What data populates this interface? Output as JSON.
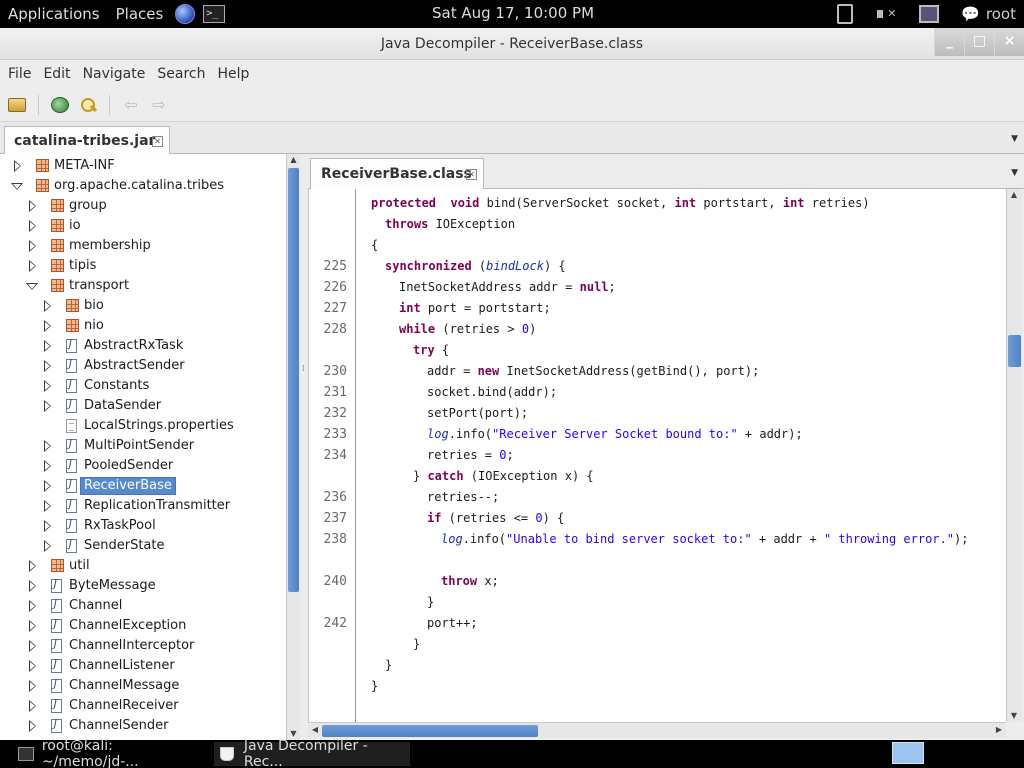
{
  "top_panel": {
    "applications": "Applications",
    "places": "Places",
    "clock": "Sat Aug 17, 10:00 PM",
    "user": "root"
  },
  "window": {
    "title": "Java Decompiler - ReceiverBase.class",
    "minimize": "_",
    "maximize": "□",
    "close": "×"
  },
  "menu": [
    "File",
    "Edit",
    "Navigate",
    "Search",
    "Help"
  ],
  "jar_tab": {
    "label": "catalina-tribes.jar"
  },
  "code_tab": {
    "label": "ReceiverBase.class"
  },
  "tree": [
    {
      "label": "META-INF",
      "icon": "package",
      "toggle": "collapsed",
      "depth": 0
    },
    {
      "label": "org.apache.catalina.tribes",
      "icon": "package",
      "toggle": "expanded",
      "depth": 0
    },
    {
      "label": "group",
      "icon": "package",
      "toggle": "collapsed",
      "depth": 1
    },
    {
      "label": "io",
      "icon": "package",
      "toggle": "collapsed",
      "depth": 1
    },
    {
      "label": "membership",
      "icon": "package",
      "toggle": "collapsed",
      "depth": 1
    },
    {
      "label": "tipis",
      "icon": "package",
      "toggle": "collapsed",
      "depth": 1
    },
    {
      "label": "transport",
      "icon": "package",
      "toggle": "expanded",
      "depth": 1
    },
    {
      "label": "bio",
      "icon": "package",
      "toggle": "collapsed",
      "depth": 2
    },
    {
      "label": "nio",
      "icon": "package",
      "toggle": "collapsed",
      "depth": 2
    },
    {
      "label": "AbstractRxTask",
      "icon": "class",
      "toggle": "collapsed",
      "depth": 2
    },
    {
      "label": "AbstractSender",
      "icon": "class",
      "toggle": "collapsed",
      "depth": 2
    },
    {
      "label": "Constants",
      "icon": "class",
      "toggle": "collapsed",
      "depth": 2
    },
    {
      "label": "DataSender",
      "icon": "class",
      "toggle": "collapsed",
      "depth": 2
    },
    {
      "label": "LocalStrings.properties",
      "icon": "file",
      "toggle": "none",
      "depth": 2
    },
    {
      "label": "MultiPointSender",
      "icon": "class",
      "toggle": "collapsed",
      "depth": 2
    },
    {
      "label": "PooledSender",
      "icon": "class",
      "toggle": "collapsed",
      "depth": 2
    },
    {
      "label": "ReceiverBase",
      "icon": "class",
      "toggle": "collapsed",
      "depth": 2,
      "selected": true
    },
    {
      "label": "ReplicationTransmitter",
      "icon": "class",
      "toggle": "collapsed",
      "depth": 2
    },
    {
      "label": "RxTaskPool",
      "icon": "class",
      "toggle": "collapsed",
      "depth": 2
    },
    {
      "label": "SenderState",
      "icon": "class",
      "toggle": "collapsed",
      "depth": 2
    },
    {
      "label": "util",
      "icon": "package",
      "toggle": "collapsed",
      "depth": 1
    },
    {
      "label": "ByteMessage",
      "icon": "class",
      "toggle": "collapsed",
      "depth": 1
    },
    {
      "label": "Channel",
      "icon": "class",
      "toggle": "collapsed",
      "depth": 1
    },
    {
      "label": "ChannelException",
      "icon": "class",
      "toggle": "collapsed",
      "depth": 1
    },
    {
      "label": "ChannelInterceptor",
      "icon": "class",
      "toggle": "collapsed",
      "depth": 1
    },
    {
      "label": "ChannelListener",
      "icon": "class",
      "toggle": "collapsed",
      "depth": 1
    },
    {
      "label": "ChannelMessage",
      "icon": "class",
      "toggle": "collapsed",
      "depth": 1
    },
    {
      "label": "ChannelReceiver",
      "icon": "class",
      "toggle": "collapsed",
      "depth": 1
    },
    {
      "label": "ChannelSender",
      "icon": "class",
      "toggle": "collapsed",
      "depth": 1
    }
  ],
  "code": [
    {
      "ln": "",
      "indent": 0,
      "toks": [
        [
          "kw",
          "protected"
        ],
        [
          "",
          "  "
        ],
        [
          "kw",
          "void"
        ],
        [
          "",
          " bind(ServerSocket socket, "
        ],
        [
          "kw",
          "int"
        ],
        [
          "",
          " portstart, "
        ],
        [
          "kw",
          "int"
        ],
        [
          "",
          " retries)"
        ]
      ]
    },
    {
      "ln": "",
      "indent": 1,
      "toks": [
        [
          "kw",
          "throws"
        ],
        [
          "",
          " IOException"
        ]
      ]
    },
    {
      "ln": "",
      "indent": 0,
      "toks": [
        [
          "",
          "{"
        ]
      ]
    },
    {
      "ln": "225",
      "indent": 1,
      "toks": [
        [
          "kw",
          "synchronized"
        ],
        [
          "",
          " ("
        ],
        [
          "fld",
          "bindLock"
        ],
        [
          "",
          ") {"
        ]
      ]
    },
    {
      "ln": "226",
      "indent": 2,
      "toks": [
        [
          "",
          "InetSocketAddress addr = "
        ],
        [
          "kw",
          "null"
        ],
        [
          "",
          ";"
        ]
      ]
    },
    {
      "ln": "227",
      "indent": 2,
      "toks": [
        [
          "kw",
          "int"
        ],
        [
          "",
          " port = portstart;"
        ]
      ]
    },
    {
      "ln": "228",
      "indent": 2,
      "toks": [
        [
          "kw",
          "while"
        ],
        [
          "",
          " (retries > "
        ],
        [
          "num",
          "0"
        ],
        [
          "",
          ")"
        ]
      ]
    },
    {
      "ln": "",
      "indent": 3,
      "toks": [
        [
          "kw",
          "try"
        ],
        [
          "",
          " {"
        ]
      ]
    },
    {
      "ln": "230",
      "indent": 4,
      "toks": [
        [
          "",
          "addr = "
        ],
        [
          "kw",
          "new"
        ],
        [
          "",
          " InetSocketAddress(getBind(), port);"
        ]
      ]
    },
    {
      "ln": "231",
      "indent": 4,
      "toks": [
        [
          "",
          "socket.bind(addr);"
        ]
      ]
    },
    {
      "ln": "232",
      "indent": 4,
      "toks": [
        [
          "",
          "setPort(port);"
        ]
      ]
    },
    {
      "ln": "233",
      "indent": 4,
      "toks": [
        [
          "fld",
          "log"
        ],
        [
          "",
          ".info("
        ],
        [
          "str",
          "\"Receiver Server Socket bound to:\""
        ],
        [
          "",
          " + addr);"
        ]
      ]
    },
    {
      "ln": "234",
      "indent": 4,
      "toks": [
        [
          "",
          "retries = "
        ],
        [
          "num",
          "0"
        ],
        [
          "",
          ";"
        ]
      ]
    },
    {
      "ln": "",
      "indent": 3,
      "toks": [
        [
          "",
          "} "
        ],
        [
          "kw",
          "catch"
        ],
        [
          "",
          " (IOException x) {"
        ]
      ]
    },
    {
      "ln": "236",
      "indent": 4,
      "toks": [
        [
          "",
          "retries--;"
        ]
      ]
    },
    {
      "ln": "237",
      "indent": 4,
      "toks": [
        [
          "kw",
          "if"
        ],
        [
          "",
          " (retries <= "
        ],
        [
          "num",
          "0"
        ],
        [
          "",
          ") {"
        ]
      ]
    },
    {
      "ln": "238",
      "indent": 5,
      "toks": [
        [
          "fld",
          "log"
        ],
        [
          "",
          ".info("
        ],
        [
          "str",
          "\"Unable to bind server socket to:\""
        ],
        [
          "",
          " + addr + "
        ],
        [
          "str",
          "\" throwing error.\""
        ],
        [
          "",
          ");"
        ]
      ]
    },
    {
      "ln": "",
      "indent": 5,
      "toks": []
    },
    {
      "ln": "240",
      "indent": 5,
      "toks": [
        [
          "kw",
          "throw"
        ],
        [
          "",
          " x;"
        ]
      ]
    },
    {
      "ln": "",
      "indent": 4,
      "toks": [
        [
          "",
          "}"
        ]
      ]
    },
    {
      "ln": "242",
      "indent": 4,
      "toks": [
        [
          "",
          "port++;"
        ]
      ]
    },
    {
      "ln": "",
      "indent": 3,
      "toks": [
        [
          "",
          "}"
        ]
      ]
    },
    {
      "ln": "",
      "indent": 1,
      "toks": [
        [
          "",
          "}"
        ]
      ]
    },
    {
      "ln": "",
      "indent": 0,
      "toks": [
        [
          "",
          "}"
        ]
      ]
    }
  ],
  "taskbar": [
    {
      "label": "root@kali: ~/memo/jd-...",
      "icon": "terminal-icon"
    },
    {
      "label": "Java Decompiler - Rec...",
      "icon": "java-cup-icon",
      "active": true
    }
  ],
  "colors": {
    "keyword": "#7f0055",
    "string": "#2a00ff",
    "field": "#1a2fb8",
    "selection": "#5689cf"
  }
}
